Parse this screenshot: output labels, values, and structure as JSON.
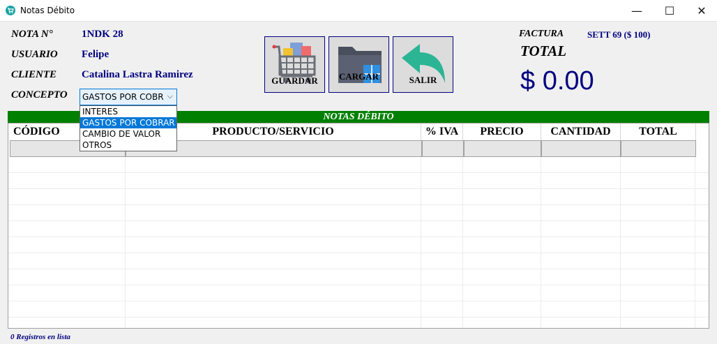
{
  "window": {
    "title": "Notas Débito",
    "minimize": "—",
    "maximize": "☐",
    "close": "✕",
    "icon": "cart-icon"
  },
  "header": {
    "nota_label": "NOTA N°",
    "nota_value": "1NDK 28",
    "usuario_label": "USUARIO",
    "usuario_value": "Felipe",
    "cliente_label": "CLIENTE",
    "cliente_value": "Catalina Lastra Ramirez",
    "concepto_label": "CONCEPTO",
    "concepto_value": "GASTOS POR COBR",
    "factura_label": "FACTURA",
    "factura_value": "SETT 69  ($ 100)",
    "total_label": "TOTAL",
    "total_value": "$ 0.00"
  },
  "concepto_options": [
    "INTERES",
    "GASTOS POR COBRAR",
    "CAMBIO DE VALOR",
    "OTROS"
  ],
  "selected_option": "GASTOS POR COBRAR",
  "buttons": {
    "guardar": "GUARDAR",
    "cargar": "CARGAR",
    "salir": "SALIR"
  },
  "grid": {
    "title": "NOTAS DÉBITO",
    "columns": [
      "CÓDIGO",
      "PRODUCTO/SERVICIO",
      "% IVA",
      "PRECIO",
      "CANTIDAD",
      "TOTAL"
    ]
  },
  "footer": {
    "status": "0 Registros en lista"
  },
  "colors": {
    "accent_green": "#008000",
    "value_navy": "#000080",
    "selection_blue": "#0078d7"
  }
}
